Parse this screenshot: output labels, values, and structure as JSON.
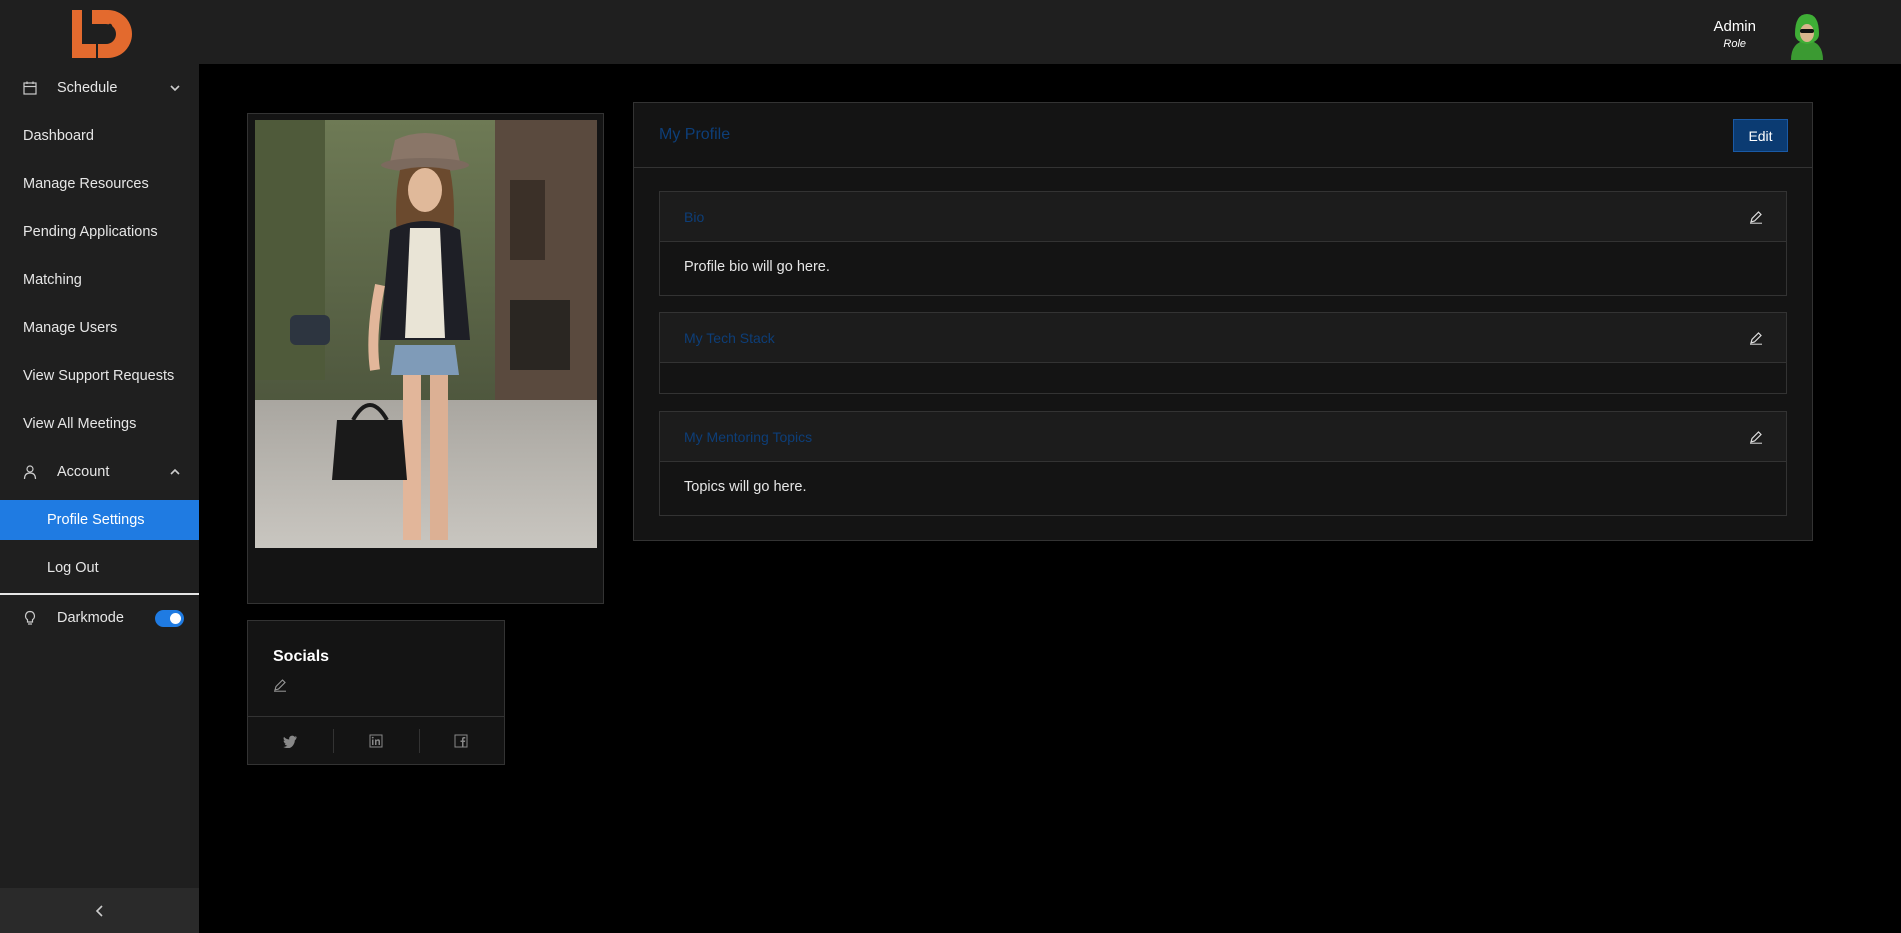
{
  "header": {
    "user_name": "Admin",
    "user_role": "Role"
  },
  "sidebar": {
    "items": [
      {
        "label": "Schedule"
      },
      {
        "label": "Dashboard"
      },
      {
        "label": "Manage Resources"
      },
      {
        "label": "Pending Applications"
      },
      {
        "label": "Matching"
      },
      {
        "label": "Manage Users"
      },
      {
        "label": "View Support Requests"
      },
      {
        "label": "View All Meetings"
      },
      {
        "label": "Account"
      },
      {
        "label": "Profile Settings"
      },
      {
        "label": "Log Out"
      },
      {
        "label": "Darkmode"
      }
    ],
    "darkmode_on": true
  },
  "socials": {
    "title": "Socials"
  },
  "profile": {
    "title": "My Profile",
    "edit_label": "Edit",
    "sections": [
      {
        "title": "Bio",
        "body": "Profile bio will go here."
      },
      {
        "title": "My Tech Stack",
        "body": ""
      },
      {
        "title": "My Mentoring Topics",
        "body": "Topics will go here."
      }
    ]
  },
  "colors": {
    "accent": "#1f7be2",
    "link_dark": "#0d3e78",
    "logo": "#e36a2e"
  }
}
